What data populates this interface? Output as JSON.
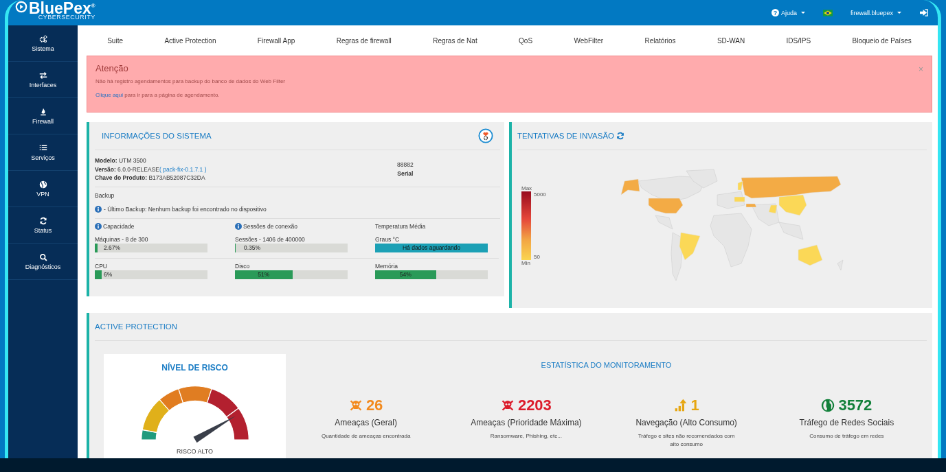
{
  "header": {
    "logo": "BluePex",
    "logo_mark": "®",
    "logo_sub": "CYBERSECURITY",
    "help_icon": "?",
    "help": "Ajuda",
    "user": "firewall.bluepex"
  },
  "sidebar": {
    "items": [
      {
        "label": "Sistema"
      },
      {
        "label": "Interfaces"
      },
      {
        "label": "Firewall"
      },
      {
        "label": "Serviços"
      },
      {
        "label": "VPN"
      },
      {
        "label": "Status"
      },
      {
        "label": "Diagnósticos"
      }
    ]
  },
  "tabs": [
    "Suite",
    "Active Protection",
    "Firewall App",
    "Regras de firewall",
    "Regras de Nat",
    "QoS",
    "WebFilter",
    "Relatórios",
    "SD-WAN",
    "IDS/IPS",
    "Bloqueio de Países"
  ],
  "alert": {
    "title": "Atenção",
    "message": "Não há registro agendamentos para backup do banco de dados do Web Filter",
    "link": "Clique aqui",
    "link_rest": "para ir para a página de agendamento.",
    "close": "×"
  },
  "system_info": {
    "title": "INFORMAÇÕES DO SISTEMA",
    "fields": [
      {
        "label": "Modelo:",
        "value": "UTM 3500"
      },
      {
        "label": "Versão:",
        "value": "6.0.0-RELEASE",
        "link": "( pack-fix-0.1.7.1 )"
      },
      {
        "label": "Chave do Produto:",
        "value": "B173AB52087C32DA"
      }
    ],
    "serial": "88882",
    "serial_label": "Serial",
    "backup_title": "Backup",
    "backup_text": "- Último Backup: Nenhum backup foi encontrado no dispositivo",
    "meters": [
      {
        "heading": "Capacidade",
        "info": true,
        "label": "Máquinas - 8 de 300",
        "kind": "bar",
        "level": 0.0267,
        "reading": "2.67%"
      },
      {
        "heading": "Sessões de conexão",
        "info": true,
        "label": "Sessões - 1406 de 400000",
        "kind": "bar",
        "level": 0.0035,
        "reading": "0.35%"
      },
      {
        "heading": "Temperatura Média",
        "info": false,
        "label": "Graus °C",
        "kind": "message",
        "reading": "Há dados aguardando"
      },
      {
        "label": "CPU",
        "kind": "bar",
        "level": 0.06,
        "reading": "6%"
      },
      {
        "label": "Disco",
        "kind": "bar",
        "level": 0.51,
        "reading": "51%"
      },
      {
        "label": "Memória",
        "kind": "bar",
        "level": 0.54,
        "reading": "54%"
      }
    ]
  },
  "invasion": {
    "title": "TENTATIVAS DE INVASÃO",
    "legend_max": "Max",
    "legend_max_value": "5000",
    "legend_min": "Min",
    "legend_min_value": "50"
  },
  "active_protection": {
    "title": "ACTIVE PROTECTION",
    "risk_title": "NÍVEL DE RISCO",
    "risk_label": "RISCO ALTO",
    "stats_title": "ESTATÍSTICA DO MONITORAMENTO",
    "stats": [
      {
        "kind": "skull",
        "color": "#f28a1e",
        "value": "26",
        "title": "Ameaças (Geral)",
        "description": "Quantidade de ameaças encontrada"
      },
      {
        "kind": "skull",
        "color": "#dc1c2b",
        "value": "2203",
        "title": "Ameaças (Prioridade Máxima)",
        "description": "Ransomware, Phishing, etc..."
      },
      {
        "kind": "bars",
        "color": "#e6a612",
        "value": "1",
        "title": "Navegação (Alto Consumo)",
        "description": "Tráfego e sites não recomendados com alto consumo"
      },
      {
        "kind": "globe",
        "color": "#12803a",
        "value": "3572",
        "title": "Tráfego de Redes Sociais",
        "description": "Consumo de tráfego em redes"
      }
    ]
  }
}
